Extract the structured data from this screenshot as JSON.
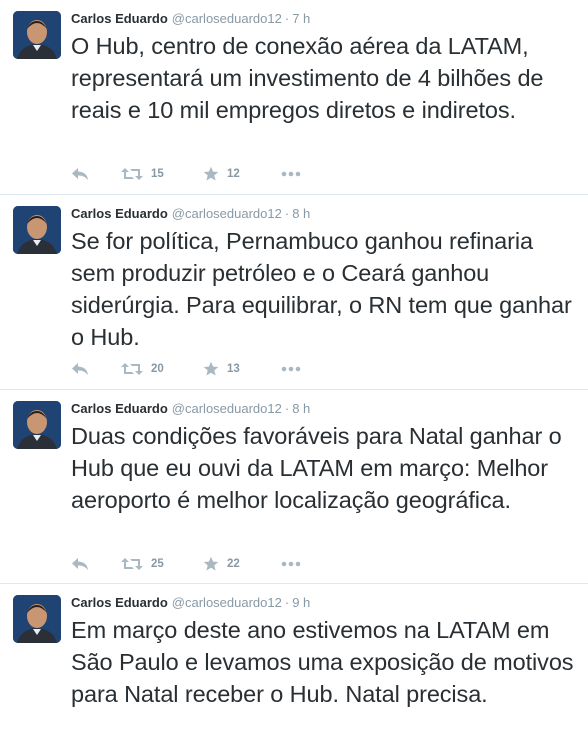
{
  "tweets": [
    {
      "name": "Carlos Eduardo",
      "handle": "@carloseduardo12",
      "separator": "·",
      "time": "7 h",
      "text": "O Hub, centro de conexão aérea da LATAM, representará um investimento de 4 bilhões de reais e 10 mil empregos diretos e indiretos.",
      "retweets": "15",
      "favorites": "12"
    },
    {
      "name": "Carlos Eduardo",
      "handle": "@carloseduardo12",
      "separator": "·",
      "time": "8 h",
      "text": "Se for política, Pernambuco ganhou refinaria sem produzir petróleo e o Ceará ganhou siderúrgia. Para equilibrar,  o RN tem que ganhar o Hub.",
      "retweets": "20",
      "favorites": "13"
    },
    {
      "name": "Carlos Eduardo",
      "handle": "@carloseduardo12",
      "separator": "·",
      "time": "8 h",
      "text": "Duas condições favoráveis para Natal ganhar o Hub que eu ouvi da LATAM em março: Melhor aeroporto é melhor localização geográfica.",
      "retweets": "25",
      "favorites": "22"
    },
    {
      "name": "Carlos Eduardo",
      "handle": "@carloseduardo12",
      "separator": "·",
      "time": "9 h",
      "text": "Em março deste ano estivemos na LATAM em São Paulo e levamos uma exposição de motivos para Natal receber o Hub. Natal precisa."
    }
  ],
  "icons": {
    "reply": "reply-icon",
    "retweet": "retweet-icon",
    "favorite": "star-icon",
    "more": "more-icon"
  },
  "colors": {
    "text": "#292f33",
    "muted": "#8899a6",
    "icon": "#aab8c2",
    "divider": "#e1e8ed"
  }
}
